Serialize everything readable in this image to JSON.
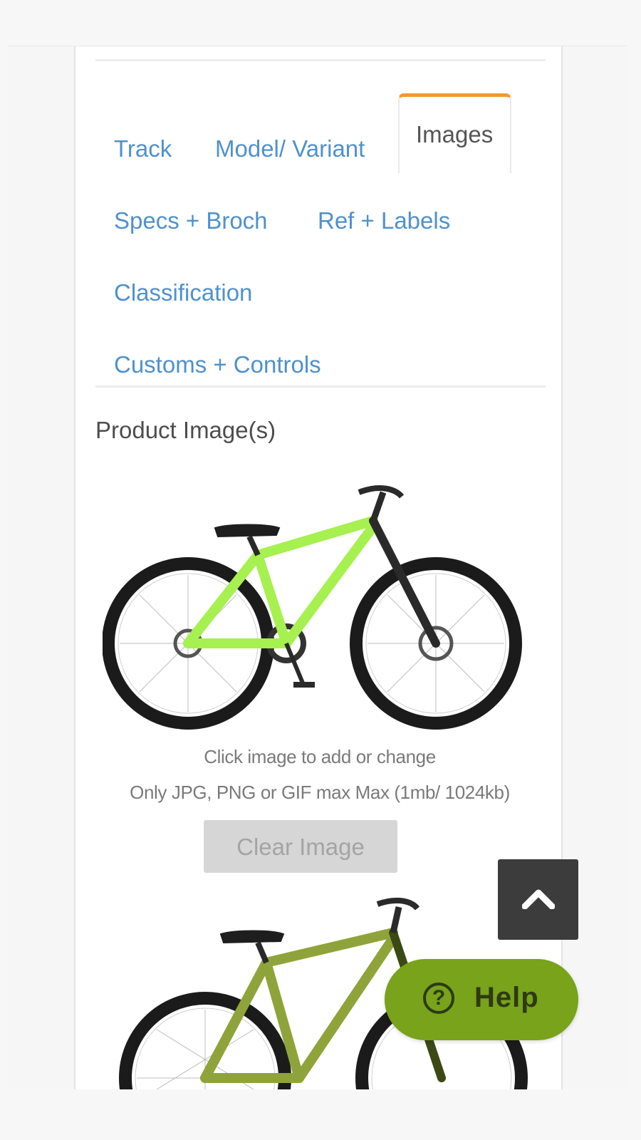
{
  "tabs": [
    {
      "label": "Track",
      "active": false
    },
    {
      "label": "Model/ Variant",
      "active": false
    },
    {
      "label": "Images",
      "active": true
    },
    {
      "label": "Specs + Broch",
      "active": false
    },
    {
      "label": "Ref + Labels",
      "active": false
    },
    {
      "label": "Classification",
      "active": false
    },
    {
      "label": "Customs + Controls",
      "active": false
    }
  ],
  "images_section": {
    "title": "Product Image(s)",
    "hint_click": "Click image to add or change",
    "hint_formats": "Only JPG, PNG or GIF max Max (1mb/ 1024kb)",
    "clear_button": "Clear Image"
  },
  "images": [
    {
      "name": "bike-photo-lime",
      "frame_color": "#a6f04f"
    },
    {
      "name": "bike-photo-olive",
      "frame_color": "#8ea43a"
    }
  ],
  "floating": {
    "back_to_top_icon": "chevron-up-icon",
    "help_label": "Help",
    "help_icon": "question-circle-icon"
  },
  "colors": {
    "tab_link": "#4f91cd",
    "tab_active_border": "#f29a2e",
    "help_button": "#78a31b",
    "back_to_top": "#3c3c3c"
  }
}
